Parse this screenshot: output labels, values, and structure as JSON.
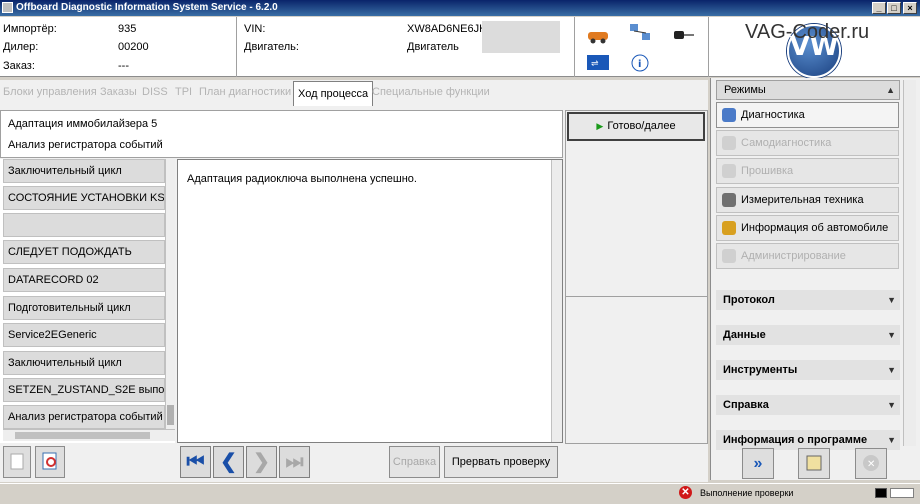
{
  "window": {
    "title": "Offboard Diagnostic Information System Service - 6.2.0"
  },
  "header": {
    "importer_label": "Импортёр:",
    "importer_value": "935",
    "dealer_label": "Дилер:",
    "dealer_value": "00200",
    "order_label": "Заказ:",
    "order_value": "---",
    "vin_label": "VIN:",
    "vin_value": "XW8AD6NE6JH",
    "engine_label": "Двигатель:",
    "engine_value": "Двигатель",
    "watermark": "VAG-Coder.ru"
  },
  "tabs": [
    {
      "label": "Блоки управления",
      "active": false
    },
    {
      "label": "Заказы",
      "active": false
    },
    {
      "label": "DISS",
      "active": false
    },
    {
      "label": "TPI",
      "active": false
    },
    {
      "label": "План диагностики",
      "active": false
    },
    {
      "label": "Ход процесса",
      "active": true
    },
    {
      "label": "Специальные функции",
      "active": false
    }
  ],
  "process": {
    "title": "Адаптация иммобилайзера 5",
    "subtitle": "Анализ регистратора событий",
    "message": "Адаптация радиоключа выполнена успешно.",
    "done_button": "Готово/далее"
  },
  "steps": [
    "Заключительный цикл",
    "СОСТОЯНИЕ УСТАНОВКИ KS",
    "",
    "СЛЕДУЕТ ПОДОЖДАТЬ",
    "DATARECORD 02",
    "Подготовительный цикл",
    "Service2EGeneric",
    "Заключительный цикл",
    "SETZEN_ZUSTAND_S2E выпо",
    "Анализ регистратора событий"
  ],
  "bottom": {
    "help_button": "Справка",
    "abort_button": "Прервать проверку"
  },
  "modes": {
    "header": "Режимы",
    "items": [
      {
        "label": "Диагностика",
        "state": "selected",
        "icon": "stethoscope-icon",
        "color": "#4a7ac8"
      },
      {
        "label": "Самодиагностика",
        "state": "disabled",
        "icon": "self-diagnosis-icon",
        "color": "#c8c8c8"
      },
      {
        "label": "Прошивка",
        "state": "disabled",
        "icon": "flash-icon",
        "color": "#c8c8c8"
      },
      {
        "label": "Измерительная техника",
        "state": "normal",
        "icon": "meter-icon",
        "color": "#606060"
      },
      {
        "label": "Информация об автомобиле",
        "state": "normal",
        "icon": "book-icon",
        "color": "#d8a020"
      },
      {
        "label": "Администрирование",
        "state": "disabled",
        "icon": "admin-icon",
        "color": "#c8c8c8"
      }
    ]
  },
  "sections": [
    "Протокол",
    "Данные",
    "Инструменты",
    "Справка",
    "Информация о программе"
  ],
  "status": {
    "text": "Выполнение проверки"
  }
}
